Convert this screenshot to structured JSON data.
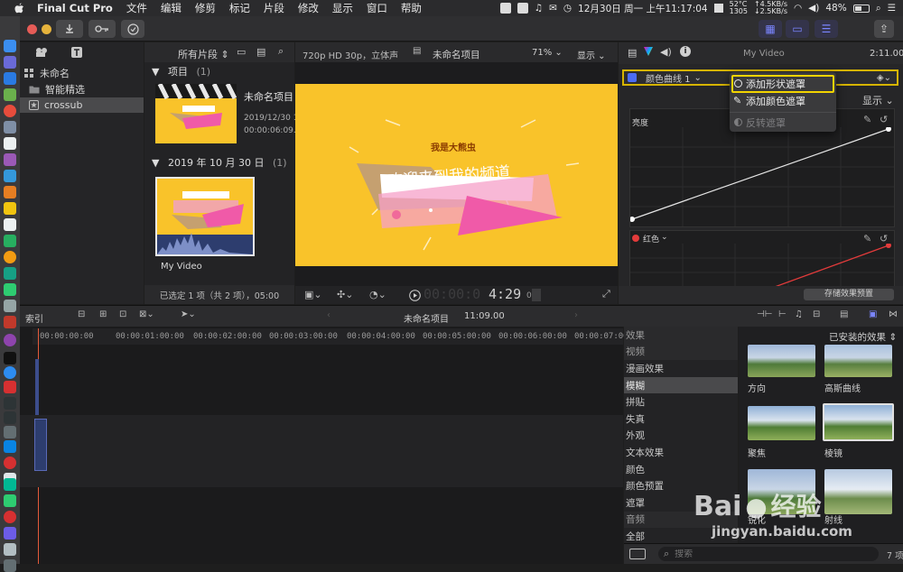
{
  "menubar": {
    "app": "Final Cut Pro",
    "items": [
      "文件",
      "编辑",
      "修剪",
      "标记",
      "片段",
      "修改",
      "显示",
      "窗口",
      "帮助"
    ],
    "temp": "52°C",
    "rpm": "1305",
    "net_up": "↑4.5KB/s",
    "net_down": "↓2.5KB/s",
    "battery": "48%",
    "clock": "12月30日 周一 上午11:17:04"
  },
  "libraries": {
    "items": [
      {
        "label": "未命名",
        "icon": "library-grid-icon"
      },
      {
        "label": "智能精选",
        "icon": "folder-icon"
      },
      {
        "label": "crossub",
        "icon": "star-icon"
      }
    ]
  },
  "browser": {
    "filter": "所有片段",
    "section_project": "项目",
    "section_project_count": "(1)",
    "project_name": "未命名项目",
    "project_date": "2019/12/30 11",
    "project_duration": "00:00:06:09.0",
    "section_date": "2019 年 10 月 30 日",
    "section_date_count": "(1)",
    "clip_name": "My Video",
    "status": "已选定 1 项（共 2 项），05:00"
  },
  "viewer": {
    "format": "720p HD 30p，立体声",
    "project": "未命名项目",
    "zoom": "71%",
    "display_label": "显示",
    "timecode_dim": "00:00:0",
    "timecode": "4:29",
    "timecode_frames": "09",
    "title_top": "我是大熊虫",
    "title_main": "欢迎来到我的频道"
  },
  "inspector": {
    "clip_name": "My Video",
    "time": "2:11.00",
    "effect_name": "颜色曲线 1",
    "display_label": "显示",
    "curve1_label": "亮度",
    "curve2_label": "红色",
    "save_preset": "存储效果预置"
  },
  "dropdown": {
    "items": [
      "添加形状遮罩",
      "添加颜色遮罩",
      "反转遮罩"
    ]
  },
  "timeline": {
    "index_label": "索引",
    "project": "未命名项目",
    "duration": "11:09.00",
    "ruler": [
      "00:00:00:00",
      "00:00:01:00:00",
      "00:00:02:00:00",
      "00:00:03:00:00",
      "00:00:04:00:00",
      "00:00:05:00:00",
      "00:00:06:00:00",
      "00:00:07:00"
    ]
  },
  "effects": {
    "header": "效果",
    "installed": "已安装的效果",
    "categories": [
      "视频",
      "漫画效果",
      "模糊",
      "拼贴",
      "失真",
      "外观",
      "文本效果",
      "颜色",
      "颜色预置",
      "遮罩",
      "音频",
      "全部"
    ],
    "thumbs": [
      "方向",
      "高斯曲线",
      "聚焦",
      "棱镜",
      "锐化",
      "射线"
    ],
    "search_placeholder": "搜索",
    "count": "7 项"
  },
  "watermark": {
    "brand": "Bai",
    "brand2": "经验",
    "url": "jingyan.baidu.com"
  },
  "colors": {
    "accent": "#d6b400",
    "frame": "#f9c32a",
    "pink": "#f05aa8",
    "curve_red": "#e33b3b"
  }
}
